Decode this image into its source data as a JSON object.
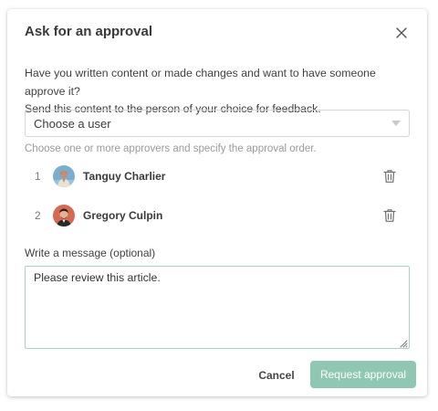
{
  "dialog": {
    "title": "Ask for an approval",
    "intro_line1": "Have you written content or made changes and want to have someone approve it?",
    "intro_line2": "Send this content to the person of your choice for feedback.",
    "user_select": {
      "placeholder": "Choose a user"
    },
    "approvers_hint": "Choose one or more approvers and specify the approval order.",
    "approvers": [
      {
        "order": "1",
        "name": "Tanguy Charlier",
        "avatar_color": "#7aaed0"
      },
      {
        "order": "2",
        "name": "Gregory Culpin",
        "avatar_color": "#d46a52"
      }
    ],
    "message_label": "Write a message (optional)",
    "message_value": "Please review this article.",
    "cancel_label": "Cancel",
    "request_label": "Request approval"
  },
  "colors": {
    "accent": "#8fc7b2",
    "textarea_border": "#a8d4c5"
  }
}
